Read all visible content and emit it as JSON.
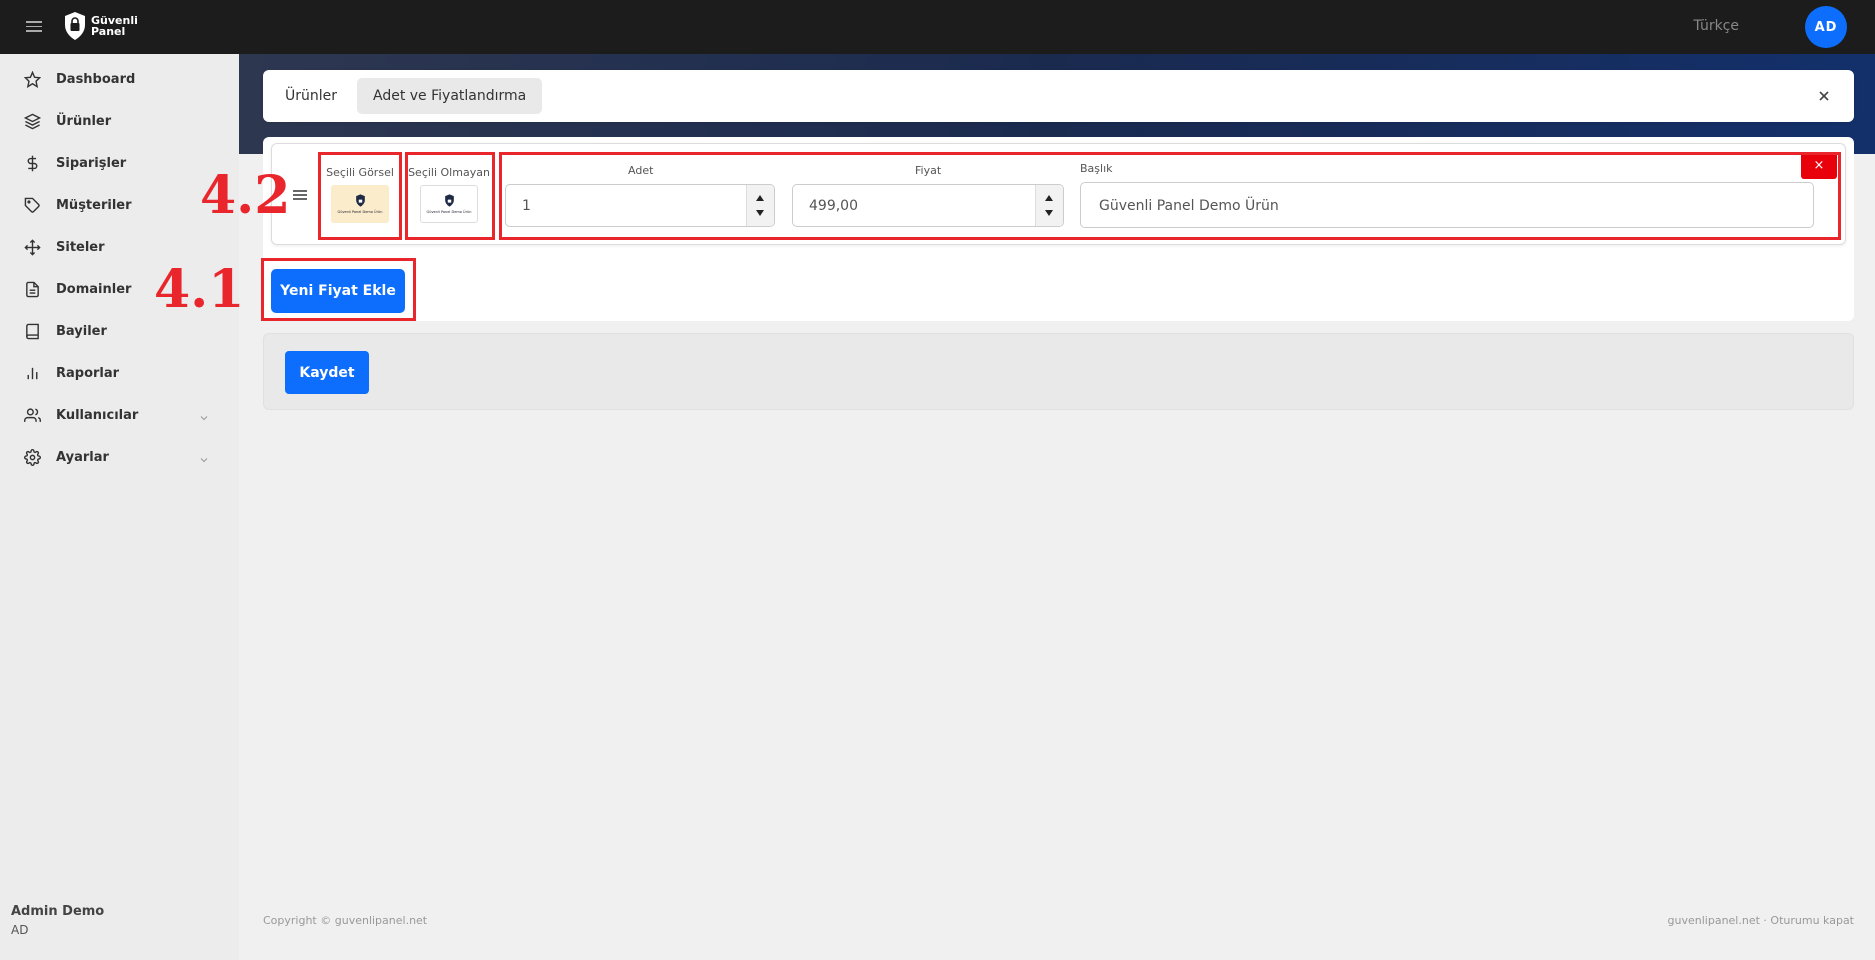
{
  "topbar": {
    "brand_line1": "Güvenli",
    "brand_line2": "Panel",
    "language": "Türkçe",
    "avatar_initials": "AD"
  },
  "sidebar": {
    "items": [
      {
        "label": "Dashboard",
        "icon": "star-icon"
      },
      {
        "label": "Ürünler",
        "icon": "layers-icon"
      },
      {
        "label": "Siparişler",
        "icon": "dollar-icon"
      },
      {
        "label": "Müşteriler",
        "icon": "tag-icon"
      },
      {
        "label": "Siteler",
        "icon": "move-icon"
      },
      {
        "label": "Domainler",
        "icon": "document-icon"
      },
      {
        "label": "Bayiler",
        "icon": "book-icon"
      },
      {
        "label": "Raporlar",
        "icon": "bar-chart-icon"
      },
      {
        "label": "Kullanıcılar",
        "icon": "users-icon",
        "expandable": true
      },
      {
        "label": "Ayarlar",
        "icon": "gear-icon",
        "expandable": true
      }
    ],
    "user_name": "Admin Demo",
    "user_initials": "AD"
  },
  "tabs": {
    "items": [
      "Ürünler",
      "Adet ve Fiyatlandırma"
    ],
    "active": "Adet ve Fiyatlandırma"
  },
  "price_row": {
    "selected_image_label": "Seçili Görsel",
    "unselected_image_label": "Seçili Olmayan",
    "thumbnail_text": "Güvenli Panel Demo Ürün",
    "quantity_label": "Adet",
    "quantity_value": "1",
    "price_label": "Fiyat",
    "price_value": "499,00",
    "title_label": "Başlık",
    "title_value": "Güvenli Panel Demo Ürün",
    "delete_label": "×"
  },
  "actions": {
    "add_price_label": "Yeni Fiyat Ekle",
    "save_label": "Kaydet"
  },
  "annotations": {
    "label_42": "4.2",
    "label_41": "4.1",
    "color": "#e8262c"
  },
  "footer": {
    "copyright": "Copyright © guvenlipanel.net",
    "site": "guvenlipanel.net",
    "separator": "·",
    "logout": "Oturumu kapat"
  },
  "colors": {
    "primary": "#0d6efd",
    "danger": "#e8000b",
    "topbar": "#1c1c1c"
  }
}
